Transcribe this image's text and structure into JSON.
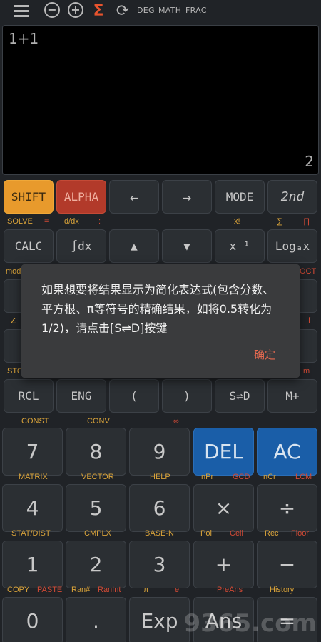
{
  "toolbar": {
    "minus_glyph": "−",
    "plus_glyph": "+",
    "sigma_glyph": "Σ",
    "refresh_glyph": "⟳",
    "deg": "DEG",
    "math": "MATH",
    "frac": "FRAC"
  },
  "display": {
    "expression": "1+1",
    "result": "2"
  },
  "keys": {
    "shift": "SHIFT",
    "alpha": "ALPHA",
    "left": "←",
    "right": "→",
    "mode": "MODE",
    "second": "2nd",
    "calc": "CALC",
    "integral": "∫dx",
    "up": "▲",
    "down": "▼",
    "inverse": "x⁻¹",
    "log": "Logₐx",
    "rcl": "RCL",
    "eng": "ENG",
    "lparen": "(",
    "rparen": ")",
    "std": "S⇌D",
    "mplus": "M+",
    "n7": "7",
    "n8": "8",
    "n9": "9",
    "del": "DEL",
    "ac": "AC",
    "n4": "4",
    "n5": "5",
    "n6": "6",
    "times": "×",
    "divide": "÷",
    "n1": "1",
    "n2": "2",
    "n3": "3",
    "plus": "+",
    "minus": "−",
    "n0": "0",
    "dot": ".",
    "exp": "Exp",
    "ans": "Ans",
    "equals": "="
  },
  "labels": {
    "solve": "SOLVE",
    "eq": "=",
    "ddx": "d/dx",
    "colon": ":",
    "xfact": "x!",
    "sum": "∑",
    "prod": "∏",
    "mod": "mod",
    "oct": "OCT",
    "angle": "∠",
    "f": "f",
    "sto": "STO",
    "m": "m",
    "const": "CONST",
    "conv": "CONV",
    "inf": "∞",
    "matrix": "MATRIX",
    "vector": "VECTOR",
    "help": "HELP",
    "npr": "nPr",
    "gcd": "GCD",
    "ncr": "nCr",
    "lcm": "LCM",
    "statdist": "STAT/DIST",
    "cmplx": "CMPLX",
    "basen": "BASE-N",
    "pol": "Pol",
    "ceil": "Ceil",
    "rec": "Rec",
    "floor": "Floor",
    "copy": "COPY",
    "paste": "PASTE",
    "ranhash": "Ran#",
    "ranint": "RanInt",
    "pi": "π",
    "e": "e",
    "preans": "PreAns",
    "history": "History"
  },
  "dialog": {
    "message": "如果想要将结果显示为简化表达式(包含分数、平方根、π等符号的精确结果，如将0.5转化为1/2)，请点击[S⇌D]按键",
    "ok": "确定"
  },
  "watermark": "9365.com"
}
